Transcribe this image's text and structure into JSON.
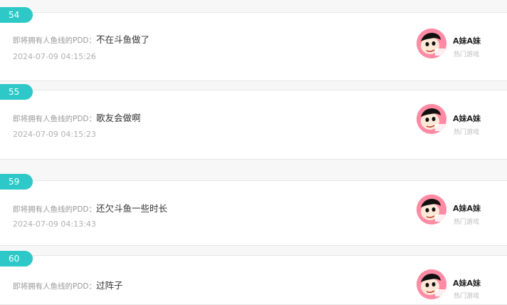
{
  "comments": [
    {
      "index": "54",
      "author": "即将拥有人鱼线的PDD：",
      "text": "不在斗鱼做了",
      "time": "2024-07-09 04:15:26",
      "user": {
        "name": "A妹A妹",
        "category": "热门游戏"
      }
    },
    {
      "index": "55",
      "author": "即将拥有人鱼线的PDD：",
      "text": "歌友会做啊",
      "time": "2024-07-09 04:15:23",
      "user": {
        "name": "A妹A妹",
        "category": "热门游戏"
      }
    },
    {
      "index": "59",
      "author": "即将拥有人鱼线的PDD：",
      "text": "还欠斗鱼一些时长",
      "time": "2024-07-09 04:13:43",
      "user": {
        "name": "A妹A妹",
        "category": "热门游戏"
      }
    },
    {
      "index": "60",
      "author": "即将拥有人鱼线的PDD：",
      "text": "过阵子",
      "time": "",
      "user": {
        "name": "A妹A妹",
        "category": "热门游戏"
      }
    }
  ],
  "colors": {
    "badge": "#2ec8c8",
    "avatar_bg": "#ff8aa3"
  }
}
